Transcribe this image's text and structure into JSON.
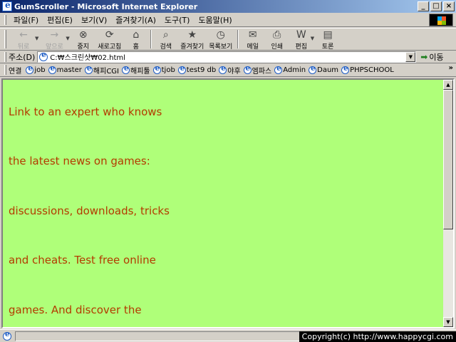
{
  "window": {
    "title": "GumScroller - Microsoft Internet Explorer",
    "buttons": {
      "minimize": "_",
      "maximize": "□",
      "close": "×"
    }
  },
  "menu": [
    {
      "label": "파일(F)"
    },
    {
      "label": "편집(E)"
    },
    {
      "label": "보기(V)"
    },
    {
      "label": "즐겨찾기(A)"
    },
    {
      "label": "도구(T)"
    },
    {
      "label": "도움말(H)"
    }
  ],
  "toolbar": {
    "back": "뒤로",
    "forward": "앞으로",
    "stop": "중지",
    "refresh": "새로고침",
    "home": "홈",
    "search": "검색",
    "favorites": "즐겨찾기",
    "history": "목록보기",
    "mail": "메일",
    "print": "인쇄",
    "edit": "편집",
    "discuss": "토론"
  },
  "address": {
    "label": "주소(D)",
    "value": "C:₩스크린샷₩02.html",
    "go_label": "이동"
  },
  "links": {
    "label": "연결",
    "items": [
      {
        "label": "job"
      },
      {
        "label": "master"
      },
      {
        "label": "해피CGI"
      },
      {
        "label": "해피툴"
      },
      {
        "label": "tjob"
      },
      {
        "label": "test9 db"
      },
      {
        "label": "야후"
      },
      {
        "label": "엠파스"
      },
      {
        "label": "Admin"
      },
      {
        "label": "Daum"
      },
      {
        "label": "PHPSCHOOL"
      }
    ],
    "more": "»"
  },
  "content": {
    "background": "#afff79",
    "text_color": "#b33b00",
    "lines": [
      "Link to an expert who knows",
      "the latest news on games:",
      "discussions, downloads, tricks",
      "and cheats. Test free online",
      "games. And discover the"
    ]
  },
  "status": {
    "copyright": "Copyright(c) http://www.happycgi.com"
  }
}
